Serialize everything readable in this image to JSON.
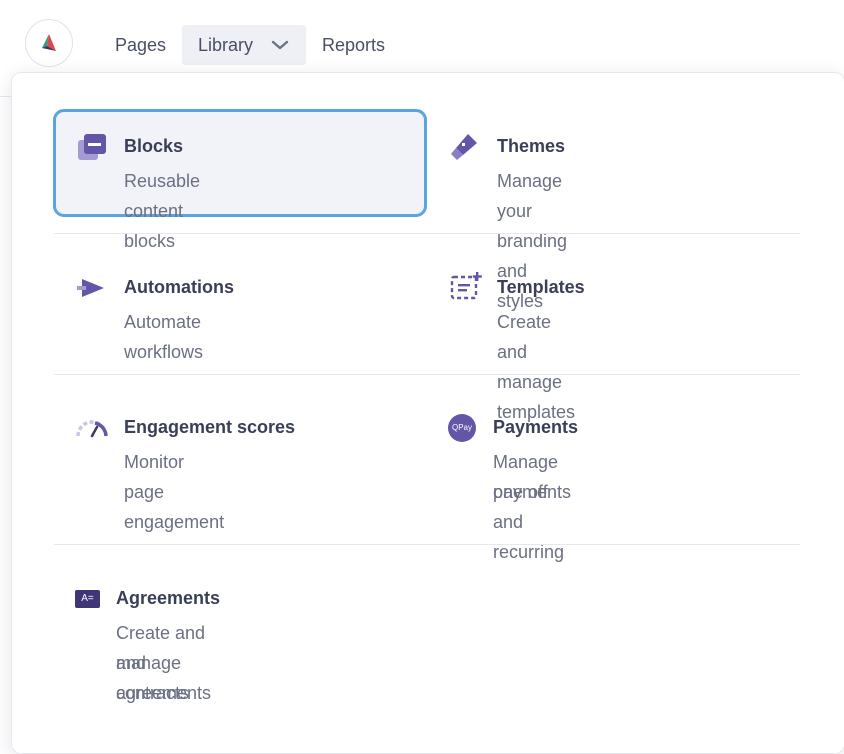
{
  "nav": {
    "pages": "Pages",
    "library": "Library",
    "reports": "Reports"
  },
  "menu": {
    "blocks": {
      "title": "Blocks",
      "desc": "Reusable content blocks",
      "icon": "blocks-icon"
    },
    "themes": {
      "title": "Themes",
      "desc": "Manage your branding and styles",
      "icon": "paintbrush-icon"
    },
    "automations": {
      "title": "Automations",
      "desc": "Automate workflows",
      "icon": "automation-icon"
    },
    "templates": {
      "title": "Templates",
      "desc": "Create and manage templates",
      "icon": "template-icon"
    },
    "engagement": {
      "title": "Engagement scores",
      "desc": "Monitor page engagement",
      "icon": "gauge-icon"
    },
    "payments": {
      "title": "Payments",
      "desc_line1": "Manage one off and recurring",
      "desc_line2": "payments",
      "icon": "qpay-icon",
      "badge": "QPay"
    },
    "agreements": {
      "title": "Agreements",
      "desc_line1": "Create and manage agreements",
      "desc_line2": "and contracts",
      "icon": "agreement-icon",
      "badge": "A="
    }
  },
  "colors": {
    "accent": "#6456a6",
    "focus_border": "#5aa5e0",
    "highlight_bg": "#f1f3f8",
    "text_primary": "#3a3f58",
    "text_secondary": "#6b7083"
  }
}
